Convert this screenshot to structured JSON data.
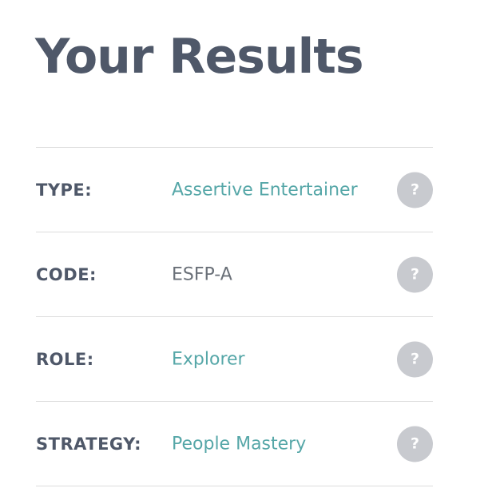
{
  "page": {
    "title": "Your Results"
  },
  "results": [
    {
      "label": "TYPE:",
      "value": "Assertive Entertainer",
      "help": "?"
    },
    {
      "label": "CODE:",
      "value": "ESFP-A",
      "help": "?"
    },
    {
      "label": "ROLE:",
      "value": "Explorer",
      "help": "?"
    },
    {
      "label": "STRATEGY:",
      "value": "People Mastery",
      "help": "?"
    }
  ],
  "colors": {
    "heading": "#4f5869",
    "accent": "#56a7a8",
    "plain_value": "#6a7078",
    "help_button": "#c8cacf",
    "divider": "#dcdcdc"
  }
}
